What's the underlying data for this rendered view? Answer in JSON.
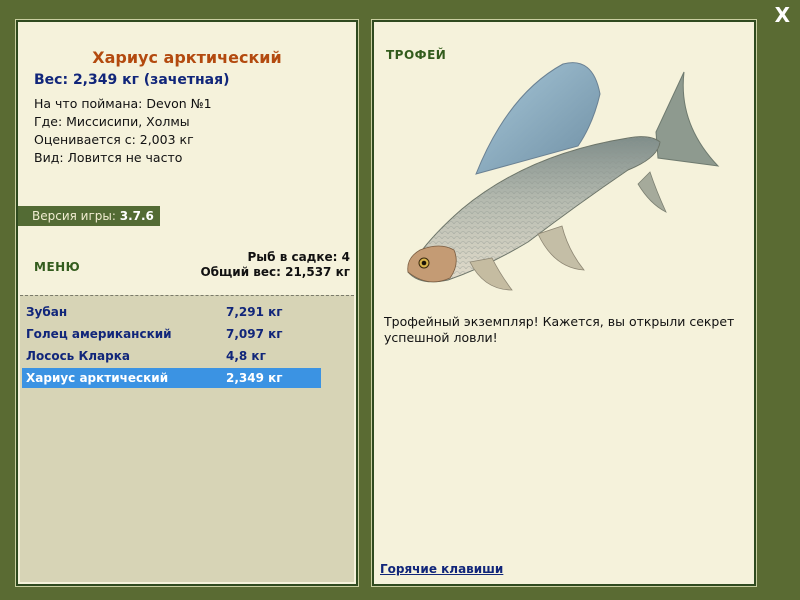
{
  "close_label": "X",
  "fish": {
    "title": "Хариус арктический",
    "weight": "Вес: 2,349 кг (зачетная)",
    "bait": "На что поймана: Devon №1",
    "location": "Где: Миссисипи, Холмы",
    "rated_from": "Оценивается с: 2,003 кг",
    "rarity": "Вид: Ловится не часто"
  },
  "version": {
    "label": "Версия игры:",
    "value": "3.7.6"
  },
  "menu_label": "МЕНЮ",
  "stats": {
    "count": "Рыб в садке: 4",
    "total": "Общий вес: 21,537 кг"
  },
  "catch_list": [
    {
      "name": "Зубан",
      "weight": "7,291 кг"
    },
    {
      "name": "Голец американский",
      "weight": "7,097 кг"
    },
    {
      "name": "Лосось Кларка",
      "weight": "4,8 кг"
    },
    {
      "name": "Хариус арктический",
      "weight": "2,349 кг"
    }
  ],
  "trophy_label": "ТРОФЕЙ",
  "description": "Трофейный экземпляр! Кажется, вы открыли секрет успешной ловли!",
  "hotkeys_link": "Горячие клавиши",
  "colors": {
    "background": "#5a6b33",
    "panel": "#f5f2db",
    "selected_row": "#3b93e3",
    "title": "#b34a0f"
  }
}
